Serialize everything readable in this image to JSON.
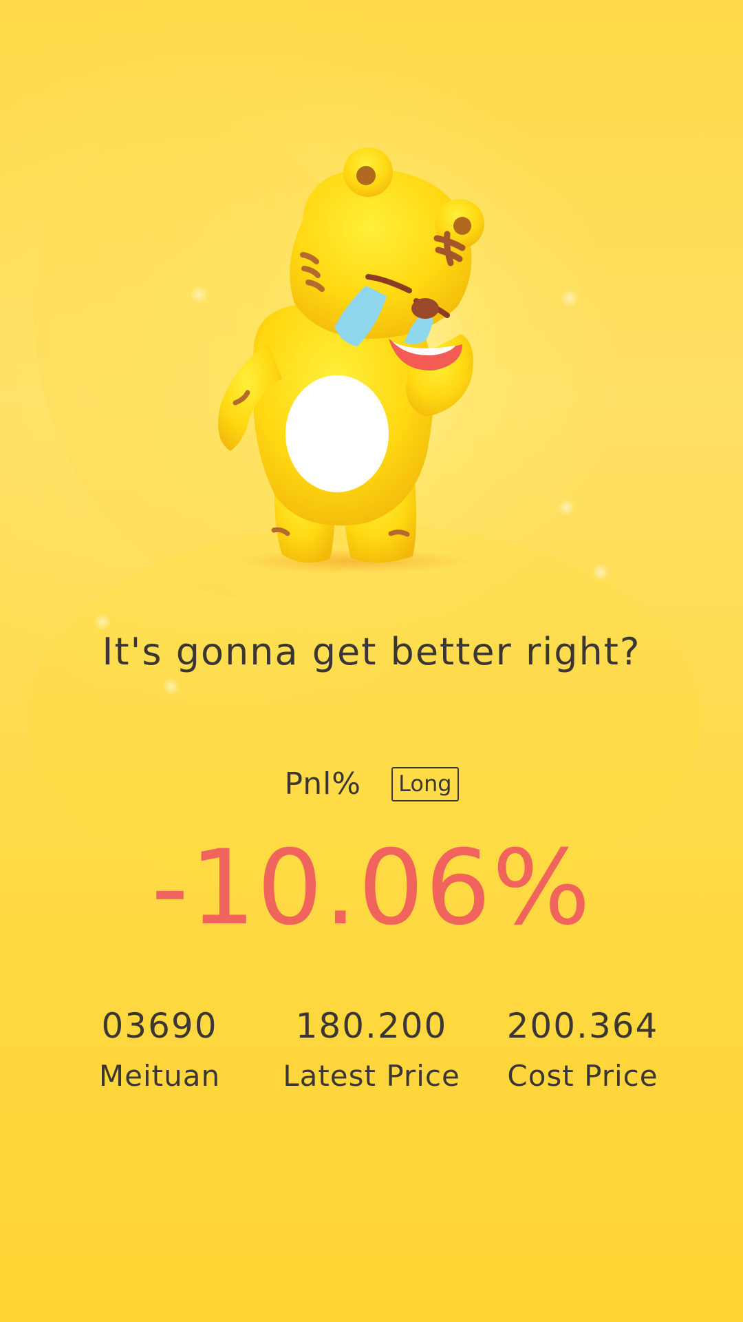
{
  "headline": "It's gonna get better right?",
  "pnl": {
    "label": "Pnl%",
    "position_type": "Long",
    "value": "-10.06%"
  },
  "stats": [
    {
      "value": "03690",
      "label": "Meituan"
    },
    {
      "value": "180.200",
      "label": "Latest Price"
    },
    {
      "value": "200.364",
      "label": "Cost Price"
    }
  ],
  "mascot": {
    "icon": "crying-tiger-mascot-icon",
    "mood": "crying"
  },
  "colors": {
    "background": "#ffd83a",
    "text": "#3b3632",
    "negative": "#f1645d"
  }
}
